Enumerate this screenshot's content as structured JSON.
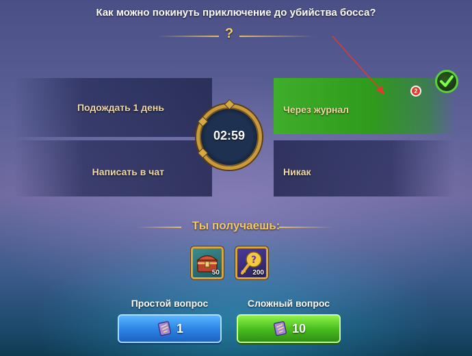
{
  "question": {
    "text": "Как можно покинуть приключение до убийства босса?",
    "mark": "?"
  },
  "answers": [
    {
      "label": "Подождать 1 день",
      "state": "neutral"
    },
    {
      "label": "Через журнал",
      "state": "correct"
    },
    {
      "label": "Написать в чат",
      "state": "neutral"
    },
    {
      "label": "Никак",
      "state": "neutral"
    }
  ],
  "timer": {
    "value": "02:59"
  },
  "annotation": {
    "badge": "2",
    "arrow_color": "#e03a2f"
  },
  "rewards": {
    "title": "Ты получаешь:",
    "items": [
      {
        "icon": "treasure-chest-icon",
        "count": "50"
      },
      {
        "icon": "golden-key-orb-icon",
        "count": "200"
      }
    ]
  },
  "buttons": {
    "simple": {
      "title": "Простой вопрос",
      "value": "1",
      "icon": "scroll-ticket-icon"
    },
    "hard": {
      "title": "Сложный вопрос",
      "value": "10",
      "icon": "scroll-ticket-icon"
    }
  },
  "colors": {
    "accent_gold": "#f3c867",
    "correct_green": "#3fae2b",
    "button_blue": "#2c86e6",
    "button_green": "#4bbf1f"
  }
}
